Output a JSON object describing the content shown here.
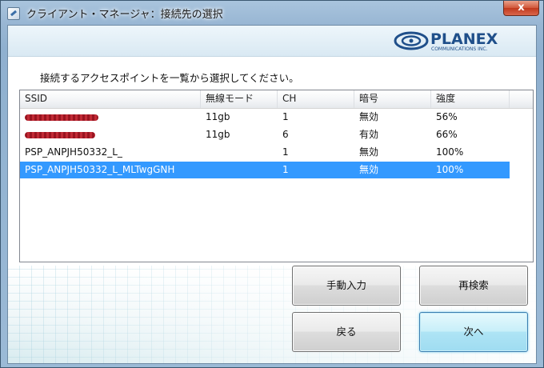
{
  "window": {
    "title": "クライアント・マネージャ：接続先の選択",
    "close_label": "x"
  },
  "brand": {
    "name": "PLANEX",
    "tagline": "COMMUNICATIONS INC."
  },
  "instruction": "接続するアクセスポイントを一覧から選択してください。",
  "list": {
    "columns": [
      "SSID",
      "無線モード",
      "CH",
      "暗号",
      "強度"
    ],
    "rows": [
      {
        "ssid": "",
        "mode": "11gb",
        "ch": "1",
        "enc": "無効",
        "strength": "56%",
        "redacted": true,
        "selected": false
      },
      {
        "ssid": "",
        "mode": "11gb",
        "ch": "6",
        "enc": "有効",
        "strength": "66%",
        "redacted": true,
        "selected": false
      },
      {
        "ssid": "PSP_ANPJH50332_L_",
        "mode": "",
        "ch": "1",
        "enc": "無効",
        "strength": "100%",
        "redacted": false,
        "selected": false
      },
      {
        "ssid": "PSP_ANPJH50332_L_MLTwgGNH",
        "mode": "",
        "ch": "1",
        "enc": "無効",
        "strength": "100%",
        "redacted": false,
        "selected": true
      }
    ]
  },
  "buttons": {
    "manual": "手動入力",
    "rescan": "再検索",
    "back": "戻る",
    "next": "次へ"
  },
  "colors": {
    "selection": "#3399ff",
    "close": "#c9482c",
    "primary_button": "#aee4f5",
    "brand_blue": "#1f4f8a"
  }
}
